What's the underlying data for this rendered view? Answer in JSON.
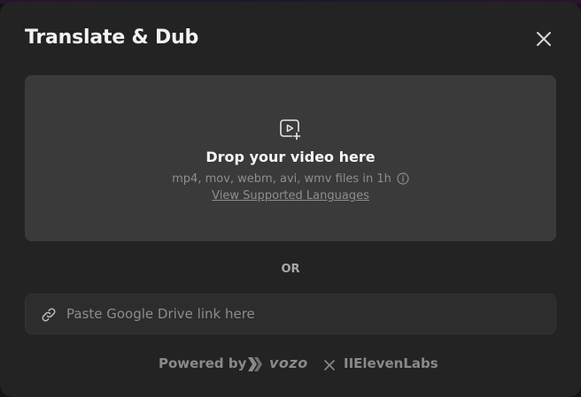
{
  "dialog": {
    "title": "Translate & Dub"
  },
  "dropzone": {
    "title": "Drop your video here",
    "formats": "mp4, mov, webm, avi, wmv files in 1h",
    "languages_link": "View Supported Languages"
  },
  "divider": {
    "label": "OR"
  },
  "link_field": {
    "placeholder": "Paste Google Drive link here",
    "value": ""
  },
  "footer": {
    "powered_by": "Powered by",
    "brand": "vozo",
    "partner": "IIElevenLabs"
  },
  "icons": {
    "close": "close-icon",
    "upload": "video-upload-icon",
    "info": "info-icon",
    "link": "link-icon",
    "vozo": "vozo-logo-icon",
    "times": "times-icon"
  },
  "colors": {
    "modal_bg": "#232323",
    "dropzone_bg": "#3a3a3b",
    "field_bg": "#2d2d2e",
    "title_text": "#f2f2f2",
    "muted_text": "#8e8e8e"
  }
}
